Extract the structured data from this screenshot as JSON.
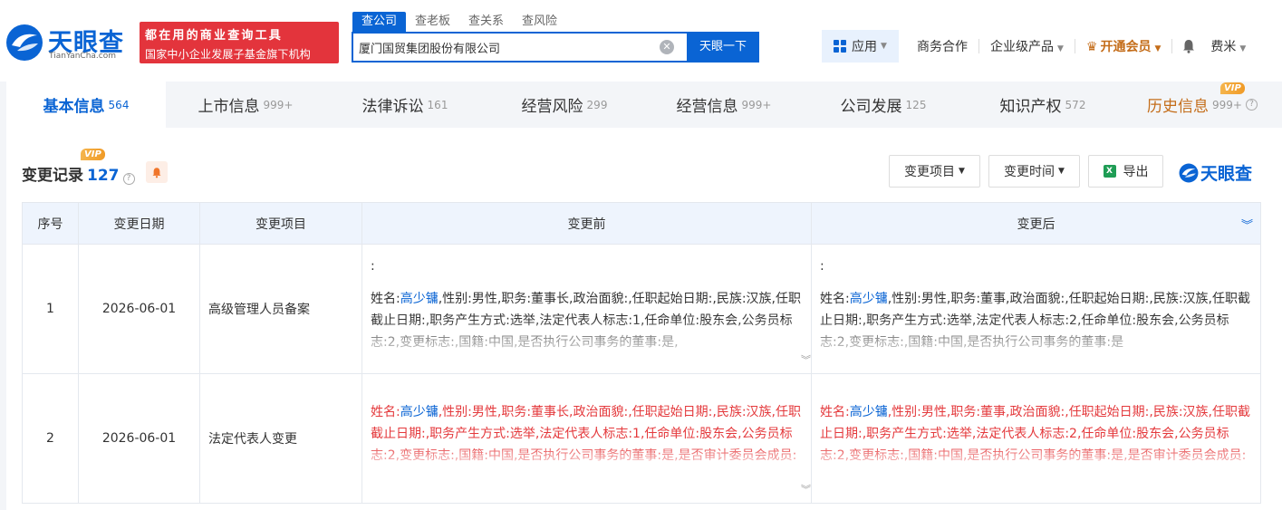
{
  "brand": {
    "name_cn": "天眼查",
    "name_en": "TianYanCha.com",
    "slogan_line1": "都在用的商业查询工具",
    "slogan_line2": "国家中小企业发展子基金旗下机构",
    "color": "#0a64d4"
  },
  "search": {
    "tabs": [
      "查公司",
      "查老板",
      "查关系",
      "查风险"
    ],
    "value": "厦门国贸集团股份有限公司",
    "button": "天眼一下"
  },
  "nav": {
    "app": "应用",
    "items": [
      "商务合作",
      "企业级产品"
    ],
    "vip": "开通会员",
    "user": "费米"
  },
  "tabs": [
    {
      "label": "基本信息",
      "count": "564"
    },
    {
      "label": "上市信息",
      "count": "999+"
    },
    {
      "label": "法律诉讼",
      "count": "161"
    },
    {
      "label": "经营风险",
      "count": "299"
    },
    {
      "label": "经营信息",
      "count": "999+"
    },
    {
      "label": "公司发展",
      "count": "125"
    },
    {
      "label": "知识产权",
      "count": "572"
    },
    {
      "label": "历史信息",
      "count": "999+"
    }
  ],
  "vip_badge": "VIP",
  "section": {
    "title": "变更记录",
    "count": "127",
    "filter_item": "变更项目",
    "filter_time": "变更时间",
    "export": "导出",
    "brand": "天眼查"
  },
  "table": {
    "headers": [
      "序号",
      "变更日期",
      "变更项目",
      "变更前",
      "变更后"
    ],
    "rows": [
      {
        "no": "1",
        "date": "2026-06-01",
        "item": "高级管理人员备案",
        "before_prefix": ":",
        "before_label": "姓名:",
        "before_name": "高少镛",
        "before_rest": ",性别:男性,职务:董事长,政治面貌:,任职起始日期:,民族:汉族,任职截止日期:,职务产生方式:选举,法定代表人标志:1,任命单位:股东会,公务员标志:2,变更标志:,国籍:中国,是否执行公司事务的董事:是,",
        "after_prefix": ":",
        "after_label": "姓名:",
        "after_name": "高少镛",
        "after_rest": ",性别:男性,职务:董事,政治面貌:,任职起始日期:,民族:汉族,任职截止日期:,职务产生方式:选举,法定代表人标志:2,任命单位:股东会,公务员标志:2,变更标志:,国籍:中国,是否执行公司事务的董事:是"
      },
      {
        "no": "2",
        "date": "2026-06-01",
        "item": "法定代表人变更",
        "before_label": "姓名:",
        "before_name": "高少镛",
        "before_rest": ",性别:男性,职务:董事长,政治面貌:,任职起始日期:,民族:汉族,任职截止日期:,职务产生方式:选举,法定代表人标志:1,任命单位:股东会,公务员标志:2,变更标志:,国籍:中国,是否执行公司事务的董事:是,是否审计委员会成员:",
        "after_label": "姓名:",
        "after_name": "高少镛",
        "after_rest": ",性别:男性,职务:董事,政治面貌:,任职起始日期:,民族:汉族,任职截止日期:,职务产生方式:选举,法定代表人标志:2,任命单位:股东会,公务员标志:2,变更标志:,国籍:中国,是否执行公司事务的董事:是,是否审计委员会成员:"
      }
    ]
  },
  "colors": {
    "accent": "#0a64d4",
    "danger": "#e4393c",
    "vip": "#c46d1a"
  }
}
